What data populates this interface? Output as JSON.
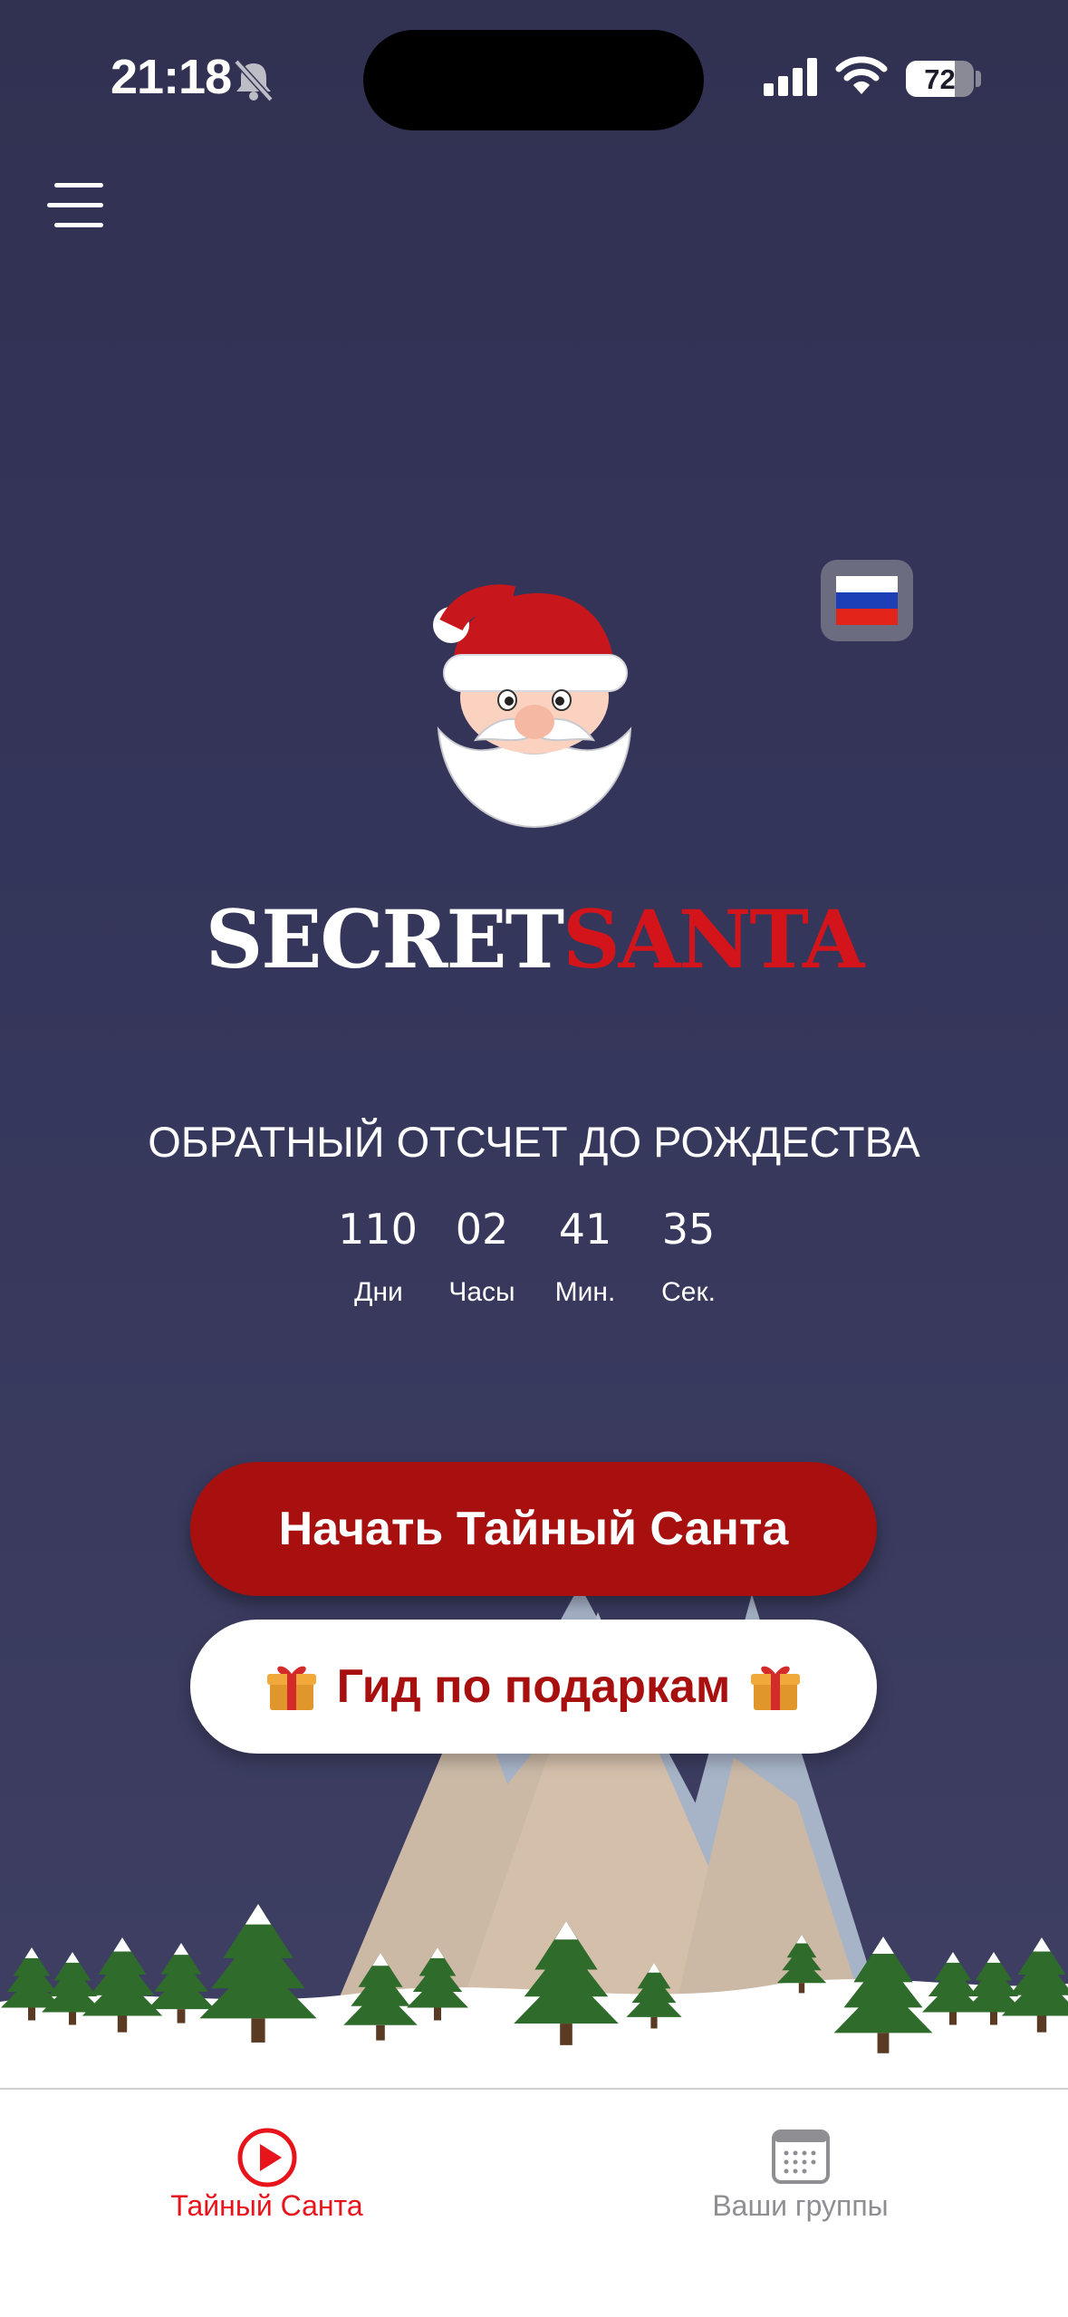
{
  "status_bar": {
    "time": "21:18",
    "battery": "72",
    "battery_level": 0.72
  },
  "logo": {
    "part1": "SECRET",
    "part2": "SANTA"
  },
  "countdown": {
    "title": "ОБРАТНЫЙ ОТСЧЕТ ДО РОЖДЕСТВА",
    "units": [
      {
        "value": "110",
        "label": "Дни"
      },
      {
        "value": "02",
        "label": "Часы"
      },
      {
        "value": "41",
        "label": "Мин."
      },
      {
        "value": "35",
        "label": "Сек."
      }
    ]
  },
  "actions": {
    "start_label": "Начать Тайный Санта",
    "gift_guide_label": "Гид по подаркам"
  },
  "tabs": [
    {
      "label": "Тайный Санта",
      "active": true,
      "icon": "play-circle-icon"
    },
    {
      "label": "Ваши группы",
      "active": false,
      "icon": "calendar-icon"
    }
  ],
  "colors": {
    "accent": "#a81010",
    "background": "#34355a",
    "inactive": "#8e8e93"
  }
}
